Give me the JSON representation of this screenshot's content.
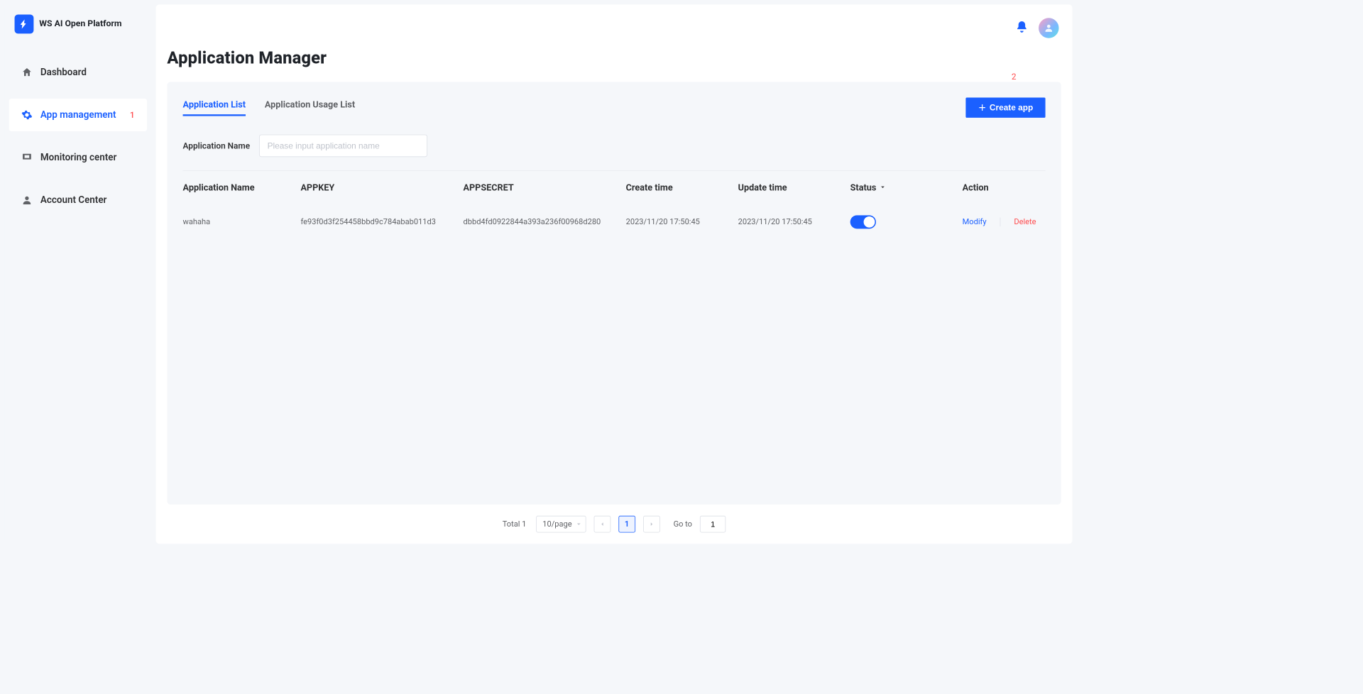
{
  "brand": {
    "title": "WS AI Open Platform"
  },
  "sidebar": {
    "items": [
      {
        "label": "Dashboard"
      },
      {
        "label": "App management",
        "badge": "1"
      },
      {
        "label": "Monitoring center"
      },
      {
        "label": "Account Center"
      }
    ]
  },
  "annot": {
    "two": "2"
  },
  "page": {
    "title": "Application Manager"
  },
  "tabs": {
    "app_list": "Application List",
    "usage_list": "Application Usage List"
  },
  "actions": {
    "create": "Create app"
  },
  "filter": {
    "label": "Application Name",
    "placeholder": "Please input application name"
  },
  "table": {
    "columns": {
      "app_name": "Application Name",
      "appkey": "APPKEY",
      "appsecret": "APPSECRET",
      "create_time": "Create time",
      "update_time": "Update time",
      "status": "Status",
      "action": "Action"
    },
    "row_actions": {
      "modify": "Modify",
      "delete": "Delete"
    },
    "rows": [
      {
        "app_name": "wahaha",
        "appkey": "fe93f0d3f254458bbd9c784abab011d3",
        "appsecret": "dbbd4fd0922844a393a236f00968d280",
        "create_time": "2023/11/20 17:50:45",
        "update_time": "2023/11/20 17:50:45",
        "status": true
      }
    ]
  },
  "pagination": {
    "total_label": "Total 1",
    "page_size_label": "10/page",
    "current_page": "1",
    "goto_label": "Go to",
    "goto_value": "1"
  }
}
